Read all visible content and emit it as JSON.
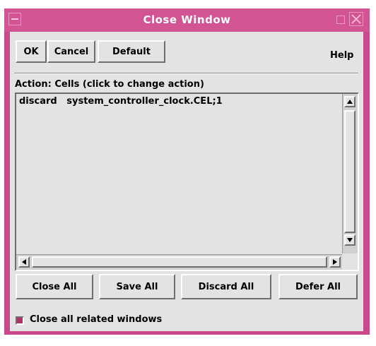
{
  "window": {
    "title": "Close Window"
  },
  "toolbar": {
    "ok_label": "OK",
    "cancel_label": "Cancel",
    "default_label": "Default",
    "help_label": "Help"
  },
  "action": {
    "label": "Action:  Cells (click to change action)"
  },
  "list": {
    "items": [
      {
        "action": "discard",
        "name": "system_controller_clock.CEL;1",
        "text": "discard   system_controller_clock.CEL;1"
      }
    ]
  },
  "bottom_buttons": {
    "close_all": "Close All",
    "save_all": "Save All",
    "discard_all": "Discard All",
    "defer_all": "Defer All"
  },
  "options": {
    "close_related_label": "Close all related windows",
    "close_related_checked": true
  },
  "colors": {
    "titlebar": "#d35493",
    "frame": "#c9498a",
    "panel": "#e3e3e3",
    "checkbox_on": "#b0306a"
  },
  "icons": {
    "window_menu": "window-menu-icon",
    "minimize": "minimize-icon",
    "close": "close-icon",
    "scroll_up": "arrow-up-icon",
    "scroll_down": "arrow-down-icon",
    "scroll_left": "arrow-left-icon",
    "scroll_right": "arrow-right-icon"
  }
}
